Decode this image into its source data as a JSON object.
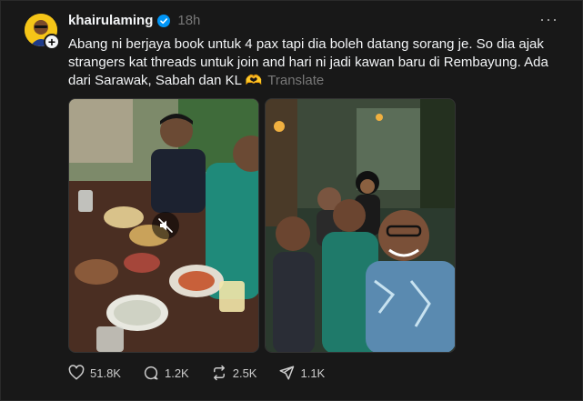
{
  "post": {
    "username": "khairulaming",
    "time": "18h",
    "more_label": "···",
    "text": "Abang ni berjaya book untuk 4 pax tapi dia boleh datang sorang je. So dia ajak strangers kat threads untuk join and hari ni jadi kawan baru di Rembayung. Ada dari Sarawak, Sabah dan KL 🫶",
    "translate_label": "Translate",
    "avatar_plus": "+"
  },
  "media": [
    {
      "type": "video",
      "description_icon": "mute-icon"
    },
    {
      "type": "image"
    }
  ],
  "actions": {
    "likes": "51.8K",
    "comments": "1.2K",
    "reposts": "2.5K",
    "shares": "1.1K"
  },
  "colors": {
    "background": "#181818",
    "text": "#f3f5f7",
    "muted": "#777777",
    "verified": "#0095f6",
    "avatar_bg": "#f5c518"
  }
}
